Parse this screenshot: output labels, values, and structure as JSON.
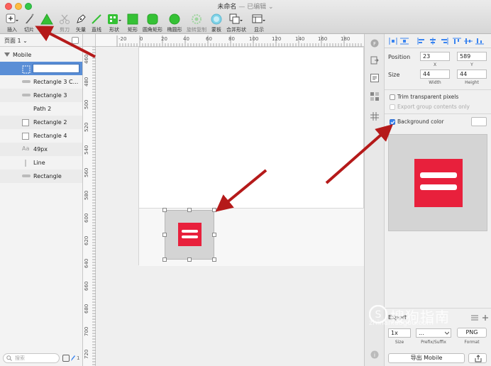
{
  "window": {
    "title": "未命名",
    "subtitle": "— 已编辑 ⌄"
  },
  "toolbar": {
    "items": [
      {
        "label": "插入",
        "icon": "plus-icon"
      },
      {
        "label": "切片",
        "icon": "knife-icon"
      },
      {
        "label": "",
        "icon": "triangle-icon"
      },
      {
        "label": "剪刀",
        "icon": "scissors-icon"
      },
      {
        "label": "矢量",
        "icon": "pen-icon"
      },
      {
        "label": "直线",
        "icon": "line-icon"
      },
      {
        "label": "形状",
        "icon": "shapes-icon"
      },
      {
        "label": "矩形",
        "icon": "rectangle-icon"
      },
      {
        "label": "圆角矩形",
        "icon": "rounded-rectangle-icon"
      },
      {
        "label": "椭圆形",
        "icon": "oval-icon"
      },
      {
        "label": "旋转复制",
        "icon": "rotate-copy-icon"
      },
      {
        "label": "蒙板",
        "icon": "mask-icon"
      },
      {
        "label": "合并形状",
        "icon": "combine-icon"
      },
      {
        "label": "显示",
        "icon": "view-icon"
      }
    ]
  },
  "sidebar": {
    "pages_label": "页面 1 ⌄",
    "group": "Mobile",
    "layers": [
      {
        "name": "",
        "icon": "slice-icon",
        "selected": true
      },
      {
        "name": "Rectangle 3 C...",
        "icon": "rectangle-layer-icon"
      },
      {
        "name": "Rectangle 3",
        "icon": "rectangle-layer-icon"
      },
      {
        "name": "Path 2",
        "icon": "path-icon"
      },
      {
        "name": "Rectangle 2",
        "icon": "square-layer-icon"
      },
      {
        "name": "Rectangle 4",
        "icon": "square-layer-icon"
      },
      {
        "name": "49px",
        "icon": "text-layer-icon"
      },
      {
        "name": "Line",
        "icon": "line-layer-icon"
      },
      {
        "name": "Rectangle",
        "icon": "rectangle-layer-icon"
      }
    ],
    "text_icon_glyph": "Aa",
    "search_placeholder": "搜索",
    "footer_count": "1"
  },
  "rulers": {
    "horizontal": [
      "-20",
      "0",
      "20",
      "40",
      "60",
      "80",
      "100",
      "120",
      "140",
      "160",
      "180"
    ],
    "vertical": [
      "460",
      "480",
      "500",
      "520",
      "540",
      "560",
      "580",
      "600",
      "620",
      "640",
      "660",
      "680",
      "700",
      "720"
    ]
  },
  "inspector": {
    "position_label": "Position",
    "position_x": "23",
    "position_y": "589",
    "x_label": "X",
    "y_label": "Y",
    "size_label": "Size",
    "width": "44",
    "height": "44",
    "width_label": "Width",
    "height_label": "Height",
    "trim_label": "Trim transparent pixels",
    "export_group_label": "Export group contents only",
    "bg_color_label": "Background color",
    "bg_color_checked": true,
    "export_header": "Export",
    "export_scale": "1x",
    "export_suffix": "...",
    "export_format": "PNG",
    "size_sub": "Size",
    "prefix_sub": "Prefix/Suffix",
    "format_sub": "Format",
    "export_button": "导出 Mobile"
  },
  "watermark": {
    "text": "搜狗指南",
    "url": "zhinan.sogou.com"
  },
  "colors": {
    "icon_red": "#e8203c",
    "accent_blue": "#3a84f0",
    "arrow": "#b51a1a",
    "green_tool": "#35c135",
    "selected_row": "#5a8ed6"
  }
}
